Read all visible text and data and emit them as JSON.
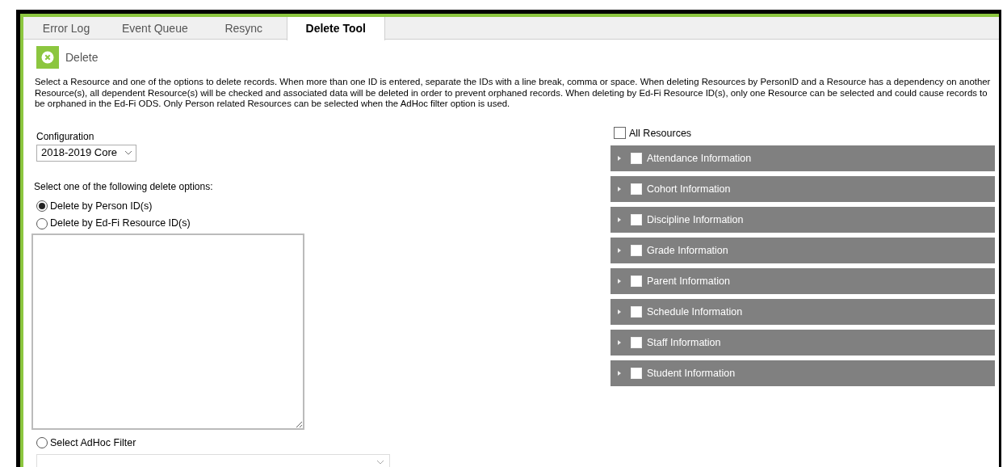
{
  "tabs": [
    {
      "label": "Error Log",
      "selected": false
    },
    {
      "label": "Event Queue",
      "selected": false
    },
    {
      "label": "Resync",
      "selected": false
    },
    {
      "label": "Delete Tool",
      "selected": true
    }
  ],
  "toolbar": {
    "button": "Delete"
  },
  "description": "Select a Resource and one of the options to delete records. When more than one ID is entered, separate the IDs with a line break, comma or space. When deleting Resources by PersonID and a Resource has a dependency on another Resource(s), all dependent Resource(s) will be checked and associated data will be deleted in order to prevent orphaned records. When deleting by Ed-Fi Resource ID(s), only one Resource can be selected and could cause records to be orphaned in the Ed-Fi ODS. Only Person related Resources can be selected when the AdHoc filter option is used.",
  "configuration": {
    "label": "Configuration",
    "value": "2018-2019 Core"
  },
  "options_label": "Select one of the following delete options:",
  "options": [
    {
      "label": "Delete by Person ID(s)",
      "selected": true
    },
    {
      "label": "Delete by Ed-Fi Resource ID(s)",
      "selected": false
    }
  ],
  "adhoc": {
    "label": "Select AdHoc Filter",
    "selected": false
  },
  "all_resources": {
    "label": "All Resources",
    "checked": false
  },
  "resources": [
    {
      "label": "Attendance Information",
      "checked": false,
      "expanded": false
    },
    {
      "label": "Cohort Information",
      "checked": false,
      "expanded": false
    },
    {
      "label": "Discipline Information",
      "checked": false,
      "expanded": false
    },
    {
      "label": "Grade Information",
      "checked": false,
      "expanded": false
    },
    {
      "label": "Parent Information",
      "checked": false,
      "expanded": false
    },
    {
      "label": "Schedule Information",
      "checked": false,
      "expanded": false
    },
    {
      "label": "Staff Information",
      "checked": false,
      "expanded": false
    },
    {
      "label": "Student Information",
      "checked": false,
      "expanded": false
    }
  ]
}
